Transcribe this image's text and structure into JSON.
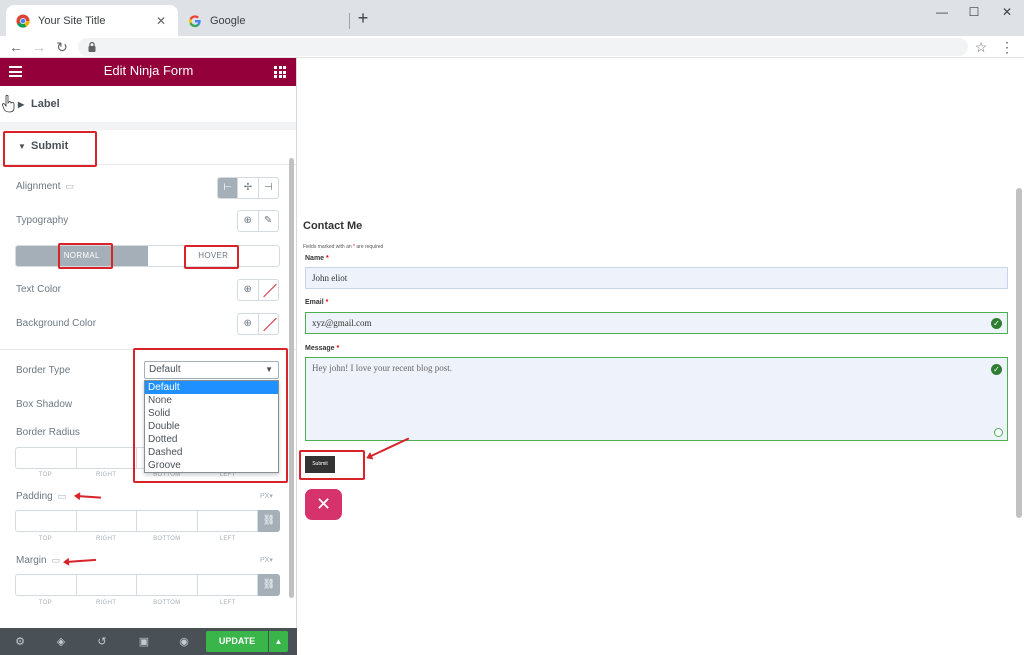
{
  "browser": {
    "tabs": [
      {
        "title": "Your Site Title",
        "icon": "chrome-icon",
        "close": "✕"
      },
      {
        "title": "Google",
        "icon": "google-g-icon"
      }
    ],
    "new_tab": "+",
    "window_controls": {
      "minimize": "—",
      "maximize": "☐",
      "close": "✕"
    },
    "nav": {
      "back": "←",
      "forward": "→",
      "reload": "↻"
    },
    "bookmark": "☆",
    "menu": "⋮"
  },
  "editor": {
    "title": "Edit Ninja Form",
    "sections": {
      "label": {
        "caret": "▶",
        "title": "Label"
      },
      "submit": {
        "caret": "▼",
        "title": "Submit"
      }
    },
    "alignment": {
      "label": "Alignment",
      "device": "▭",
      "options": [
        "⊢",
        "✢",
        "⊣"
      ]
    },
    "typography": {
      "label": "Typography",
      "globe": "⊕",
      "edit": "✎"
    },
    "state_tabs": {
      "normal": "NORMAL",
      "hover": "HOVER"
    },
    "text_color": {
      "label": "Text Color",
      "globe": "⊕"
    },
    "background_color": {
      "label": "Background Color",
      "globe": "⊕"
    },
    "border_type": {
      "label": "Border Type",
      "value": "Default",
      "arrow": "▼",
      "options": [
        "Default",
        "None",
        "Solid",
        "Double",
        "Dotted",
        "Dashed",
        "Groove"
      ],
      "selected": "Default"
    },
    "box_shadow": {
      "label": "Box Shadow"
    },
    "border_radius": {
      "label": "Border Radius",
      "sublabels": [
        "TOP",
        "RIGHT",
        "BOTTOM",
        "LEFT"
      ]
    },
    "padding": {
      "label": "Padding",
      "device": "▭",
      "unit": "PX▾",
      "sublabels": [
        "TOP",
        "RIGHT",
        "BOTTOM",
        "LEFT"
      ],
      "link": "⛓"
    },
    "margin": {
      "label": "Margin",
      "device": "▭",
      "unit": "PX▾",
      "sublabels": [
        "TOP",
        "RIGHT",
        "BOTTOM",
        "LEFT"
      ],
      "link": "⛓"
    },
    "footer": {
      "icons": [
        "⚙",
        "◈",
        "↺",
        "▣",
        "◉"
      ],
      "update": "UPDATE",
      "update_caret": "▲"
    }
  },
  "form": {
    "title": "Contact Me",
    "note_prefix": "Fields marked with an ",
    "note_star": "*",
    "note_suffix": " are required",
    "name": {
      "label": "Name",
      "req": "*",
      "value": "John  eliot"
    },
    "email": {
      "label": "Email",
      "req": "*",
      "value": "xyz@gmail.com",
      "check": "✓"
    },
    "message": {
      "label": "Message",
      "req": "*",
      "value": "Hey  john!  I  love  your  recent  blog  post.",
      "check": "✓"
    },
    "submit": "Submit",
    "close_icon": "✕"
  },
  "colors": {
    "editor_header": "#93003a",
    "update_button": "#39b54a",
    "annotation_red": "#d8232a",
    "valid_green": "#4caf50",
    "close_button": "#d6336c"
  }
}
